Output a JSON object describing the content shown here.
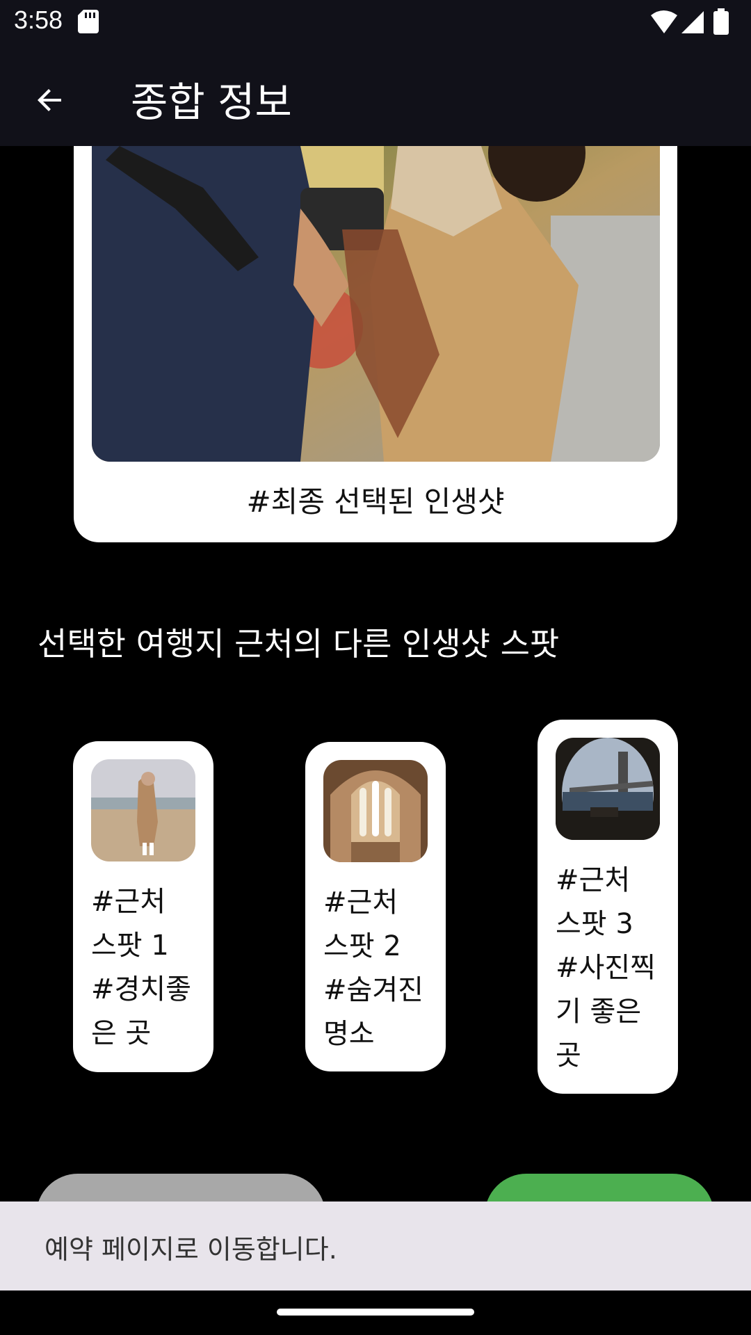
{
  "status_bar": {
    "time": "3:58"
  },
  "app_bar": {
    "title": "종합 정보"
  },
  "main_card": {
    "caption": "#최종 선택된 인생샷"
  },
  "section": {
    "title": "선택한 여행지 근처의 다른 인생샷 스팟"
  },
  "spots": [
    {
      "lines": [
        "#근처",
        "스팟 1",
        "#경치좋",
        "은 곳"
      ]
    },
    {
      "lines": [
        "#근처",
        "스팟 2",
        "#숨겨진",
        "명소"
      ]
    },
    {
      "lines": [
        "#근처",
        "스팟 3",
        "#사진찍",
        "기 좋은",
        "곳"
      ]
    }
  ],
  "buttons": {
    "left_color": "#a8a8a8",
    "right_color": "#4caf50"
  },
  "snackbar": {
    "message": "예약 페이지로 이동합니다."
  },
  "colors": {
    "bar_bg": "#111119",
    "snackbar_bg": "#e8e4eb",
    "accent_green": "#4caf50"
  }
}
